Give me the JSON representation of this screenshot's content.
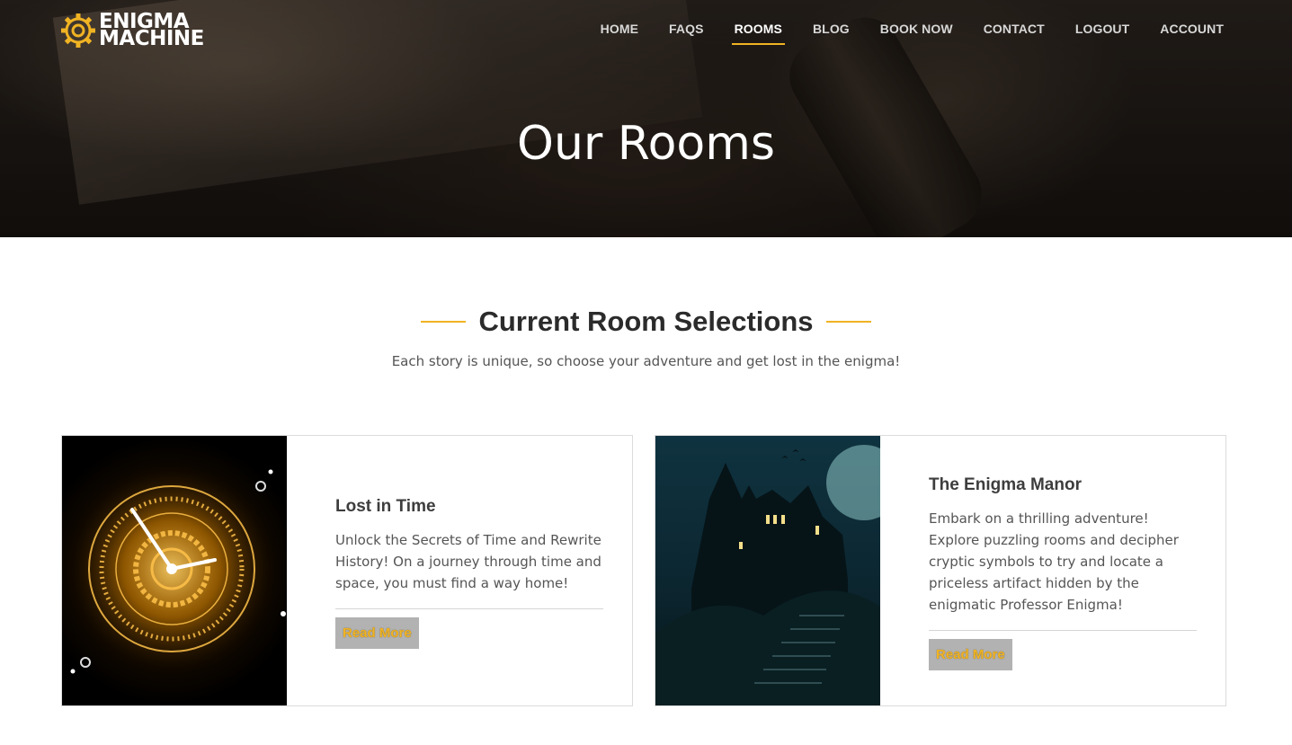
{
  "brand": {
    "line1": "ENIGMA",
    "line2": "MACHINE",
    "accent": "#f0b323"
  },
  "nav": {
    "items": [
      {
        "label": "HOME"
      },
      {
        "label": "FAQS"
      },
      {
        "label": "ROOMS",
        "active": true
      },
      {
        "label": "BLOG"
      },
      {
        "label": "BOOK NOW"
      },
      {
        "label": "CONTACT"
      },
      {
        "label": "LOGOUT"
      },
      {
        "label": "ACCOUNT"
      }
    ]
  },
  "hero": {
    "title": "Our Rooms"
  },
  "section": {
    "title": "Current Room Selections",
    "subtitle": "Each story is unique, so choose your adventure and get lost in the enigma!"
  },
  "rooms": [
    {
      "title": "Lost in Time",
      "description": "Unlock the Secrets of Time and Rewrite History! On a journey through time and space, you must find a way home!",
      "button": "Read More",
      "image_icon": "clock-image"
    },
    {
      "title": "The Enigma Manor",
      "description": "Embark on a thrilling adventure! Explore puzzling rooms and decipher cryptic symbols to try and locate a priceless artifact hidden by the enigmatic Professor Enigma!",
      "button": "Read More",
      "image_icon": "haunted-manor-image"
    }
  ]
}
